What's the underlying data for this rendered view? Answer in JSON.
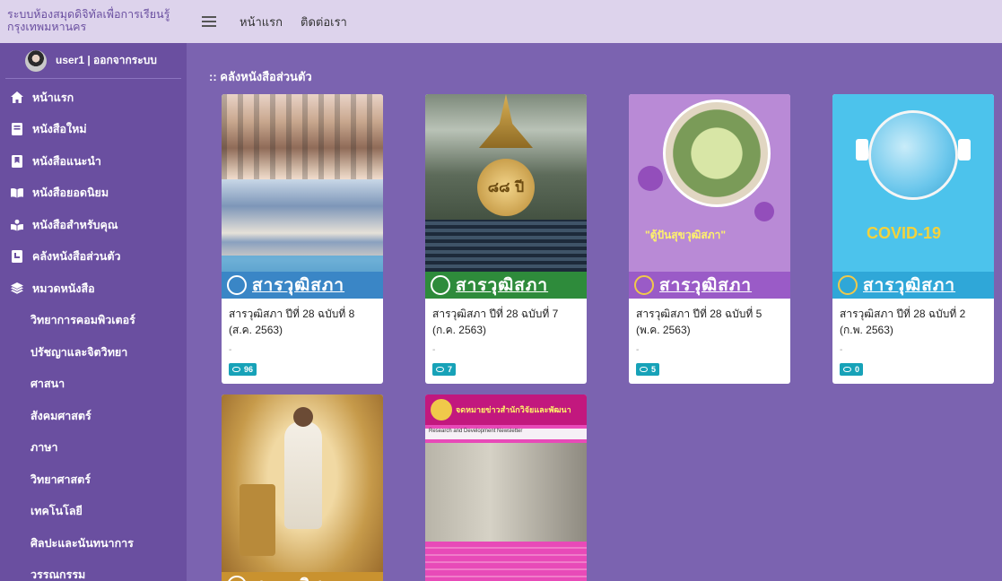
{
  "site": {
    "title": "ระบบห้องสมุดดิจิทัลเพื่อการเรียนรู้ กรุงเทพมหานคร"
  },
  "user": {
    "label": "user1 | ออกจากระบบ"
  },
  "nav": [
    {
      "label": "หน้าแรก",
      "icon": "home-icon"
    },
    {
      "label": "หนังสือใหม่",
      "icon": "book-icon"
    },
    {
      "label": "หนังสือแนะนำ",
      "icon": "bookmark-icon"
    },
    {
      "label": "หนังสือยอดนิยม",
      "icon": "open-book-icon"
    },
    {
      "label": "หนังสือสำหรับคุณ",
      "icon": "reader-icon"
    },
    {
      "label": "คลังหนังสือส่วนตัว",
      "icon": "library-icon"
    },
    {
      "label": "หมวดหนังสือ",
      "icon": "layers-icon"
    }
  ],
  "categories": [
    "วิทยาการคอมพิวเตอร์",
    "ปรัชญาและจิตวิทยา",
    "ศาสนา",
    "สังคมศาสตร์",
    "ภาษา",
    "วิทยาศาสตร์",
    "เทคโนโลยี",
    "ศิลปะและนันทนาการ",
    "วรรณกรรม"
  ],
  "topbar": {
    "links": [
      "หน้าแรก",
      "ติดต่อเรา"
    ]
  },
  "main": {
    "title": ":: คลังหนังสือส่วนตัว",
    "cover_band_text": "สารวุฒิสภา",
    "cover_overlay": {
      "magazine": "สารวุฒิสภา",
      "anniversary": "๘๘ ปี",
      "covid_caption": "\"ตู้ปันสุขวุฒิสภา\"",
      "covid_title": "COVID-19",
      "newsletter_title": "จดหมายข่าวสำนักวิจัยและพัฒนา",
      "newsletter_sub": "Research and Development Newsletter"
    },
    "books": [
      {
        "title": "สารวุฒิสภา ปีที่ 28 ฉบับที่ 8 (ส.ค. 2563)",
        "dash": "-",
        "views": "96"
      },
      {
        "title": "สารวุฒิสภา ปีที่ 28 ฉบับที่ 7 (ก.ค. 2563)",
        "dash": "-",
        "views": "7"
      },
      {
        "title": "สารวุฒิสภา ปีที่ 28 ฉบับที่ 5 (พ.ค. 2563)",
        "dash": "-",
        "views": "5"
      },
      {
        "title": "สารวุฒิสภา ปีที่ 28 ฉบับที่ 2 (ก.พ. 2563)",
        "dash": "-",
        "views": "0"
      }
    ]
  }
}
